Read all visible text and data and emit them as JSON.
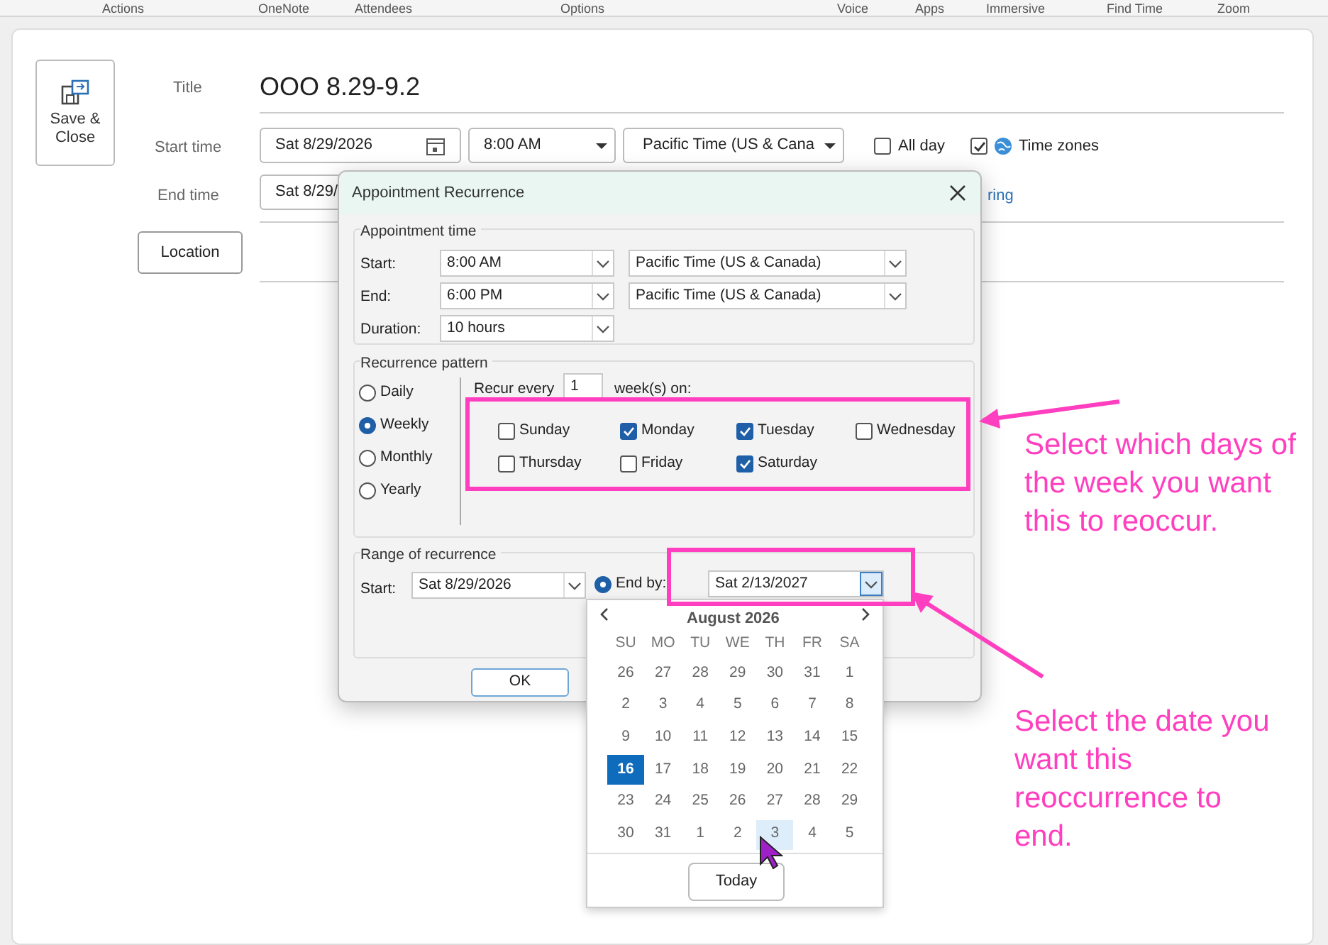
{
  "ribbon": {
    "groups": [
      "Actions",
      "OneNote",
      "Attendees",
      "Options",
      "Voice",
      "Apps",
      "Immersive",
      "Find Time",
      "Zoom"
    ]
  },
  "form": {
    "save_close": "Save & Close",
    "title_label": "Title",
    "title": "OOO 8.29-9.2",
    "start_label": "Start time",
    "start_date": "Sat 8/29/2026",
    "start_time": "8:00 AM",
    "start_timezone": "Pacific Time (US & Cana",
    "all_day": {
      "label": "All day",
      "checked": false
    },
    "time_zones": {
      "label": "Time zones",
      "checked": true
    },
    "end_label": "End time",
    "end_date": "Sat 8/29/",
    "recurring_link": "ring",
    "location_button": "Location"
  },
  "dialog": {
    "title": "Appointment Recurrence",
    "appointment_time": {
      "heading": "Appointment time",
      "rows": [
        {
          "label": "Start:",
          "value": "8:00 AM",
          "timezone": "Pacific Time (US & Canada)"
        },
        {
          "label": "End:",
          "value": "6:00 PM",
          "timezone": "Pacific Time (US & Canada)"
        },
        {
          "label": "Duration:",
          "value": "10 hours"
        }
      ]
    },
    "recurrence_pattern": {
      "heading": "Recurrence pattern",
      "options": [
        {
          "label": "Daily",
          "selected": false
        },
        {
          "label": "Weekly",
          "selected": true
        },
        {
          "label": "Monthly",
          "selected": false
        },
        {
          "label": "Yearly",
          "selected": false
        }
      ],
      "recur_every_label": "Recur every",
      "recur_every_value": "1",
      "weeks_on_label": "week(s) on:",
      "days": [
        {
          "label": "Sunday",
          "checked": false
        },
        {
          "label": "Monday",
          "checked": true
        },
        {
          "label": "Tuesday",
          "checked": true
        },
        {
          "label": "Wednesday",
          "checked": false
        },
        {
          "label": "Thursday",
          "checked": false
        },
        {
          "label": "Friday",
          "checked": false
        },
        {
          "label": "Saturday",
          "checked": true
        }
      ]
    },
    "range": {
      "heading": "Range of recurrence",
      "start_label": "Start:",
      "start_value": "Sat 8/29/2026",
      "end_by": {
        "label": "End by:",
        "selected": true
      },
      "end_date": "Sat 2/13/2027"
    },
    "ok_button": "OK"
  },
  "calendar": {
    "month": "August 2026",
    "weekdays": [
      "SU",
      "MO",
      "TU",
      "WE",
      "TH",
      "FR",
      "SA"
    ],
    "weeks": [
      [
        {
          "label": "26",
          "selected": false,
          "hovered": false
        },
        {
          "label": "27",
          "selected": false,
          "hovered": false
        },
        {
          "label": "28",
          "selected": false,
          "hovered": false
        },
        {
          "label": "29",
          "selected": false,
          "hovered": false
        },
        {
          "label": "30",
          "selected": false,
          "hovered": false
        },
        {
          "label": "31",
          "selected": false,
          "hovered": false
        },
        {
          "label": "1",
          "selected": false,
          "hovered": false
        }
      ],
      [
        {
          "label": "2",
          "selected": false,
          "hovered": false
        },
        {
          "label": "3",
          "selected": false,
          "hovered": false
        },
        {
          "label": "4",
          "selected": false,
          "hovered": false
        },
        {
          "label": "5",
          "selected": false,
          "hovered": false
        },
        {
          "label": "6",
          "selected": false,
          "hovered": false
        },
        {
          "label": "7",
          "selected": false,
          "hovered": false
        },
        {
          "label": "8",
          "selected": false,
          "hovered": false
        }
      ],
      [
        {
          "label": "9",
          "selected": false,
          "hovered": false
        },
        {
          "label": "10",
          "selected": false,
          "hovered": false
        },
        {
          "label": "11",
          "selected": false,
          "hovered": false
        },
        {
          "label": "12",
          "selected": false,
          "hovered": false
        },
        {
          "label": "13",
          "selected": false,
          "hovered": false
        },
        {
          "label": "14",
          "selected": false,
          "hovered": false
        },
        {
          "label": "15",
          "selected": false,
          "hovered": false
        }
      ],
      [
        {
          "label": "16",
          "selected": true,
          "hovered": false
        },
        {
          "label": "17",
          "selected": false,
          "hovered": false
        },
        {
          "label": "18",
          "selected": false,
          "hovered": false
        },
        {
          "label": "19",
          "selected": false,
          "hovered": false
        },
        {
          "label": "20",
          "selected": false,
          "hovered": false
        },
        {
          "label": "21",
          "selected": false,
          "hovered": false
        },
        {
          "label": "22",
          "selected": false,
          "hovered": false
        }
      ],
      [
        {
          "label": "23",
          "selected": false,
          "hovered": false
        },
        {
          "label": "24",
          "selected": false,
          "hovered": false
        },
        {
          "label": "25",
          "selected": false,
          "hovered": false
        },
        {
          "label": "26",
          "selected": false,
          "hovered": false
        },
        {
          "label": "27",
          "selected": false,
          "hovered": false
        },
        {
          "label": "28",
          "selected": false,
          "hovered": false
        },
        {
          "label": "29",
          "selected": false,
          "hovered": false
        }
      ],
      [
        {
          "label": "30",
          "selected": false,
          "hovered": false
        },
        {
          "label": "31",
          "selected": false,
          "hovered": false
        },
        {
          "label": "1",
          "selected": false,
          "hovered": false
        },
        {
          "label": "2",
          "selected": false,
          "hovered": false
        },
        {
          "label": "3",
          "selected": false,
          "hovered": true
        },
        {
          "label": "4",
          "selected": false,
          "hovered": false
        },
        {
          "label": "5",
          "selected": false,
          "hovered": false
        }
      ]
    ],
    "today_button": "Today"
  },
  "annotations": [
    {
      "text": "Select which days of the week you want this to reoccur."
    },
    {
      "text": "Select the date you want this reoccurrence to end."
    }
  ]
}
